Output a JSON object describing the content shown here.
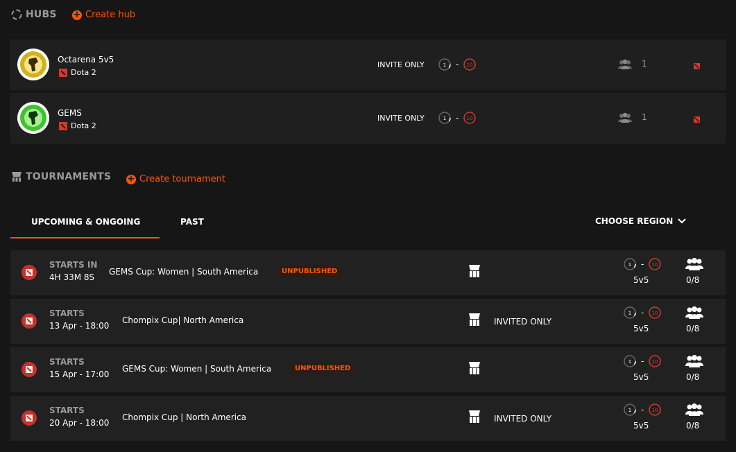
{
  "hubs_section": {
    "title": "HUBS",
    "create_label": "Create hub",
    "items": [
      {
        "name": "Octarena 5v5",
        "game": "Dota 2",
        "access": "INVITE ONLY",
        "skill_min": "1",
        "skill_max": "10",
        "members": "1",
        "badge_color": "#d4b01c"
      },
      {
        "name": "GEMS",
        "game": "Dota 2",
        "access": "INVITE ONLY",
        "skill_min": "1",
        "skill_max": "10",
        "members": "1",
        "badge_color": "#3ec42a"
      }
    ]
  },
  "tournaments_section": {
    "title": "TOURNAMENTS",
    "create_label": "Create tournament",
    "tabs": [
      "UPCOMING & ONGOING",
      "PAST"
    ],
    "active_tab": "UPCOMING & ONGOING",
    "region_label": "CHOOSE REGION",
    "items": [
      {
        "starts_label": "STARTS IN",
        "time": "4H 33M 8S",
        "name": "GEMS Cup: Women | South America",
        "badge": "UNPUBLISHED",
        "access": "",
        "skill_min": "1",
        "skill_max": "10",
        "format": "5v5",
        "slots": "0/8"
      },
      {
        "starts_label": "STARTS",
        "time": "13 Apr - 18:00",
        "name": "Chompix Cup| North America",
        "badge": "",
        "access": "INVITED ONLY",
        "skill_min": "1",
        "skill_max": "10",
        "format": "5v5",
        "slots": "0/8"
      },
      {
        "starts_label": "STARTS",
        "time": "15 Apr - 17:00",
        "name": "GEMS Cup: Women | South America",
        "badge": "UNPUBLISHED",
        "access": "",
        "skill_min": "1",
        "skill_max": "10",
        "format": "5v5",
        "slots": "0/8"
      },
      {
        "starts_label": "STARTS",
        "time": "20 Apr - 18:00",
        "name": "Chompix Cup | North America",
        "badge": "",
        "access": "INVITED ONLY",
        "skill_min": "1",
        "skill_max": "10",
        "format": "5v5",
        "slots": "0/8"
      }
    ]
  },
  "colors": {
    "accent": "#ff5500",
    "background": "#161616",
    "row": "#1f1f1f",
    "muted": "#9a9a9a",
    "danger": "#d23a2d"
  },
  "icons": [
    "hub-ring-icon",
    "plus-circle-icon",
    "dota-icon",
    "skill-level-icon",
    "members-icon",
    "menu-icon",
    "trophy-icon",
    "chevron-down-icon",
    "team-icon"
  ]
}
